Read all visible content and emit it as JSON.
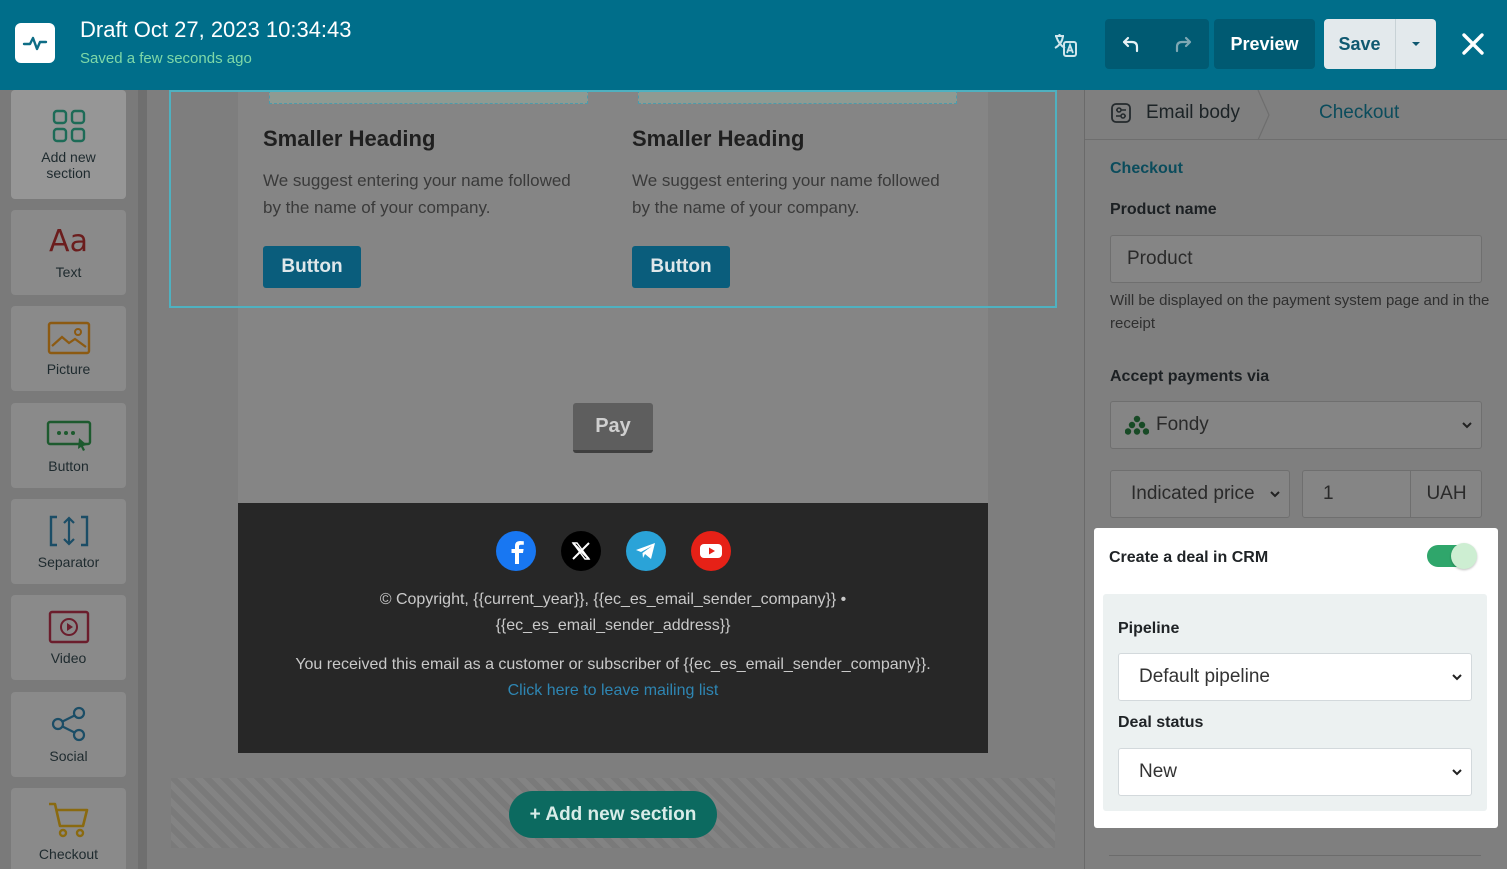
{
  "header": {
    "title": "Draft Oct 27, 2023 10:34:43",
    "subtitle": "Saved a few seconds ago",
    "preview_label": "Preview",
    "save_label": "Save"
  },
  "leftbar": {
    "items": [
      {
        "label": "Add new section",
        "icon": "grid-icon"
      },
      {
        "label": "Text",
        "icon": "text-icon"
      },
      {
        "label": "Picture",
        "icon": "picture-icon"
      },
      {
        "label": "Button",
        "icon": "button-icon"
      },
      {
        "label": "Separator",
        "icon": "separator-icon"
      },
      {
        "label": "Video",
        "icon": "video-icon"
      },
      {
        "label": "Social",
        "icon": "share-icon"
      },
      {
        "label": "Checkout",
        "icon": "cart-icon"
      }
    ]
  },
  "canvas": {
    "columns": [
      {
        "heading": "Smaller Heading",
        "text": "We suggest entering your name followed by the name of your company.",
        "button": "Button"
      },
      {
        "heading": "Smaller Heading",
        "text": "We suggest entering your name followed by the name of your company.",
        "button": "Button"
      }
    ],
    "pay_label": "Pay",
    "footer": {
      "copyright_1": "© Copyright, {{current_year}}, {{ec_es_email_sender_company}} •",
      "copyright_2": "{{ec_es_email_sender_address}}",
      "received": "You received this email as a customer or subscriber of {{ec_es_email_sender_company}}.",
      "unsubscribe": "Click here to leave mailing list"
    },
    "add_section_label": "+ Add new section"
  },
  "panel": {
    "tabs": {
      "email_body": "Email body",
      "checkout": "Checkout"
    },
    "section_title": "Checkout",
    "product_name_label": "Product name",
    "product_name_value": "Product",
    "product_hint": "Will be displayed on the payment system page and in the receipt",
    "accept_label": "Accept payments via",
    "payment_provider": "Fondy",
    "price_type": "Indicated price",
    "price_value": "1",
    "currency": "UAH",
    "crm": {
      "title": "Create a deal in CRM",
      "enabled": true,
      "pipeline_label": "Pipeline",
      "pipeline_value": "Default pipeline",
      "deal_status_label": "Deal status",
      "deal_status_value": "New"
    }
  },
  "colors": {
    "topbar": "#006e8a",
    "accent_green": "#2fa66b",
    "checkout_blue": "#0b4c5c"
  }
}
